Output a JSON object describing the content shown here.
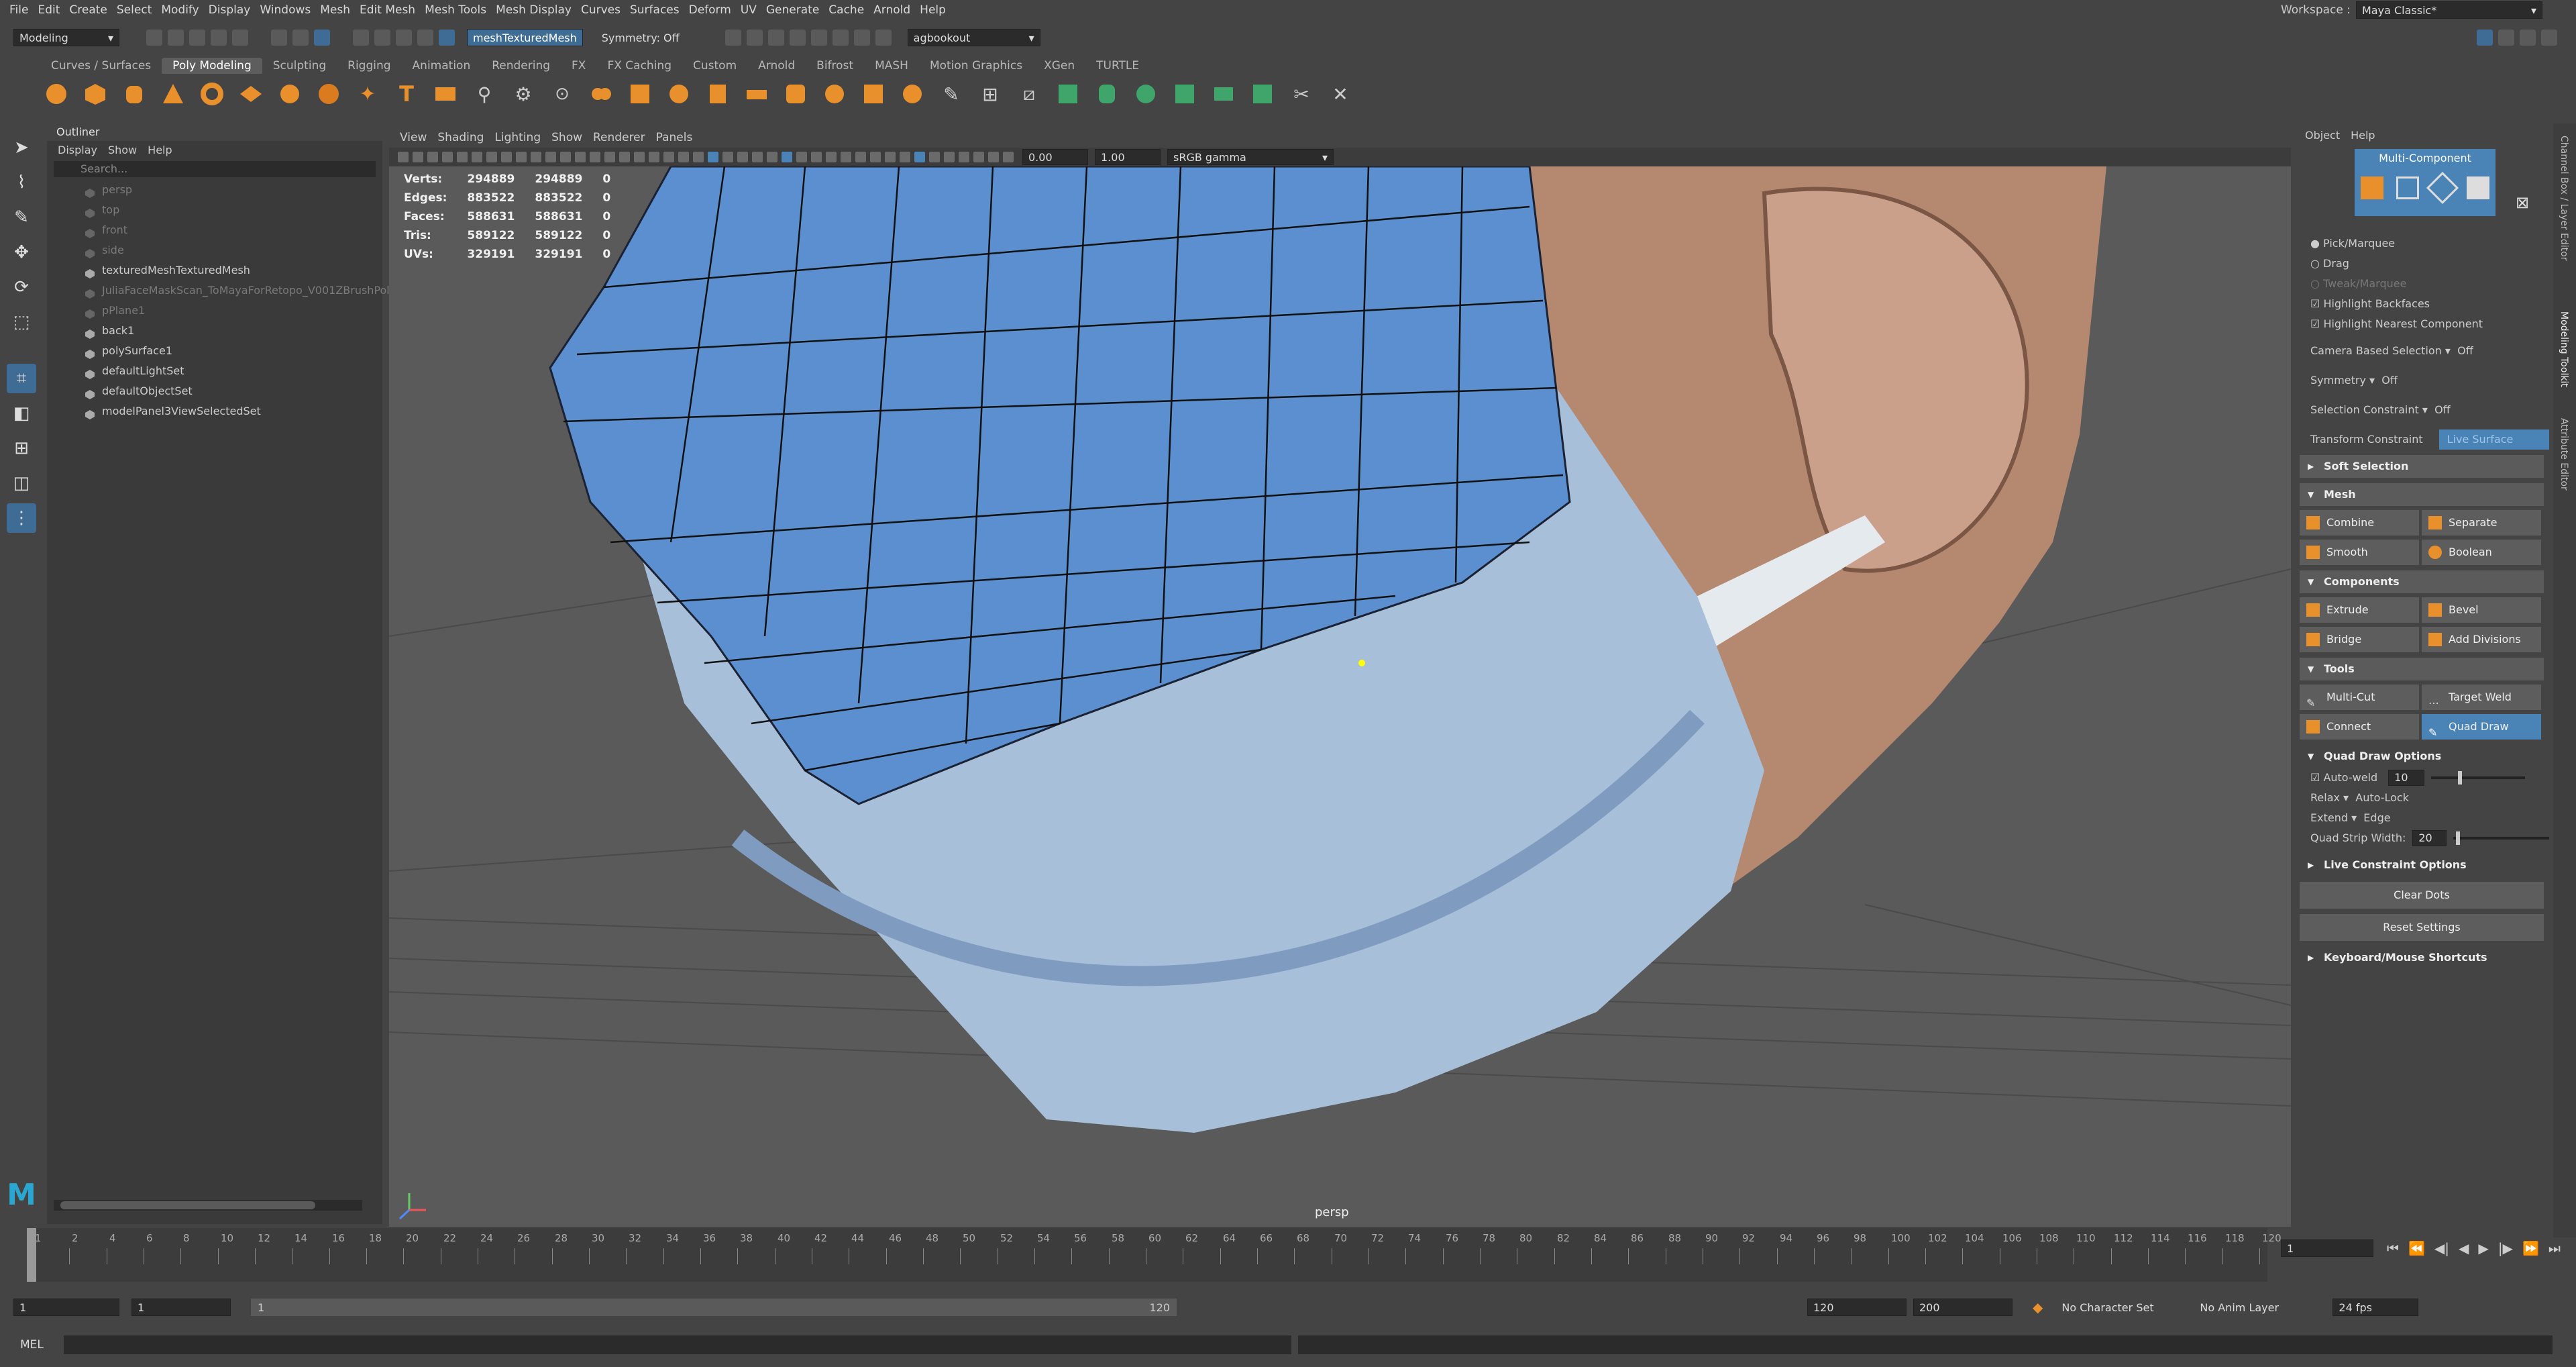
{
  "menubar": {
    "items": [
      "File",
      "Edit",
      "Create",
      "Select",
      "Modify",
      "Display",
      "Windows",
      "Mesh",
      "Edit Mesh",
      "Mesh Tools",
      "Mesh Display",
      "Curves",
      "Surfaces",
      "Deform",
      "UV",
      "Generate",
      "Cache",
      "Arnold",
      "Help"
    ]
  },
  "workspace": {
    "label": "Workspace :",
    "value": "Maya Classic*"
  },
  "statusline": {
    "mode": "Modeling",
    "live_object": "meshTexturedMesh",
    "symmetry": "Symmetry: Off",
    "camera": "agbookout"
  },
  "shelf_tabs": [
    "Curves / Surfaces",
    "Poly Modeling",
    "Sculpting",
    "Rigging",
    "Animation",
    "Rendering",
    "FX",
    "FX Caching",
    "Custom",
    "Arnold",
    "Bifrost",
    "MASH",
    "Motion Graphics",
    "XGen",
    "TURTLE"
  ],
  "shelf_active": "Poly Modeling",
  "outliner": {
    "title": "Outliner",
    "menu": [
      "Display",
      "Show",
      "Help"
    ],
    "search_placeholder": "Search...",
    "items": [
      {
        "label": "persp",
        "dim": true
      },
      {
        "label": "top",
        "dim": true
      },
      {
        "label": "front",
        "dim": true
      },
      {
        "label": "side",
        "dim": true
      },
      {
        "label": "texturedMeshTexturedMesh",
        "dim": false
      },
      {
        "label": "JuliaFaceMaskScan_ToMayaForRetopo_V001ZBrushPol",
        "dim": true
      },
      {
        "label": "pPlane1",
        "dim": true
      },
      {
        "label": "back1",
        "dim": false
      },
      {
        "label": "polySurface1",
        "dim": false
      },
      {
        "label": "defaultLightSet",
        "dim": false
      },
      {
        "label": "defaultObjectSet",
        "dim": false
      },
      {
        "label": "modelPanel3ViewSelectedSet",
        "dim": false
      }
    ]
  },
  "viewport": {
    "menu": [
      "View",
      "Shading",
      "Lighting",
      "Show",
      "Renderer",
      "Panels"
    ],
    "exposure": "0.00",
    "gamma": "1.00",
    "colorspace": "sRGB gamma",
    "camera_label": "persp",
    "hud": [
      {
        "k": "Verts:",
        "a": "294889",
        "b": "294889",
        "c": "0"
      },
      {
        "k": "Edges:",
        "a": "883522",
        "b": "883522",
        "c": "0"
      },
      {
        "k": "Faces:",
        "a": "588631",
        "b": "588631",
        "c": "0"
      },
      {
        "k": "Tris:",
        "a": "589122",
        "b": "589122",
        "c": "0"
      },
      {
        "k": "UVs:",
        "a": "329191",
        "b": "329191",
        "c": "0"
      }
    ]
  },
  "modeling_toolkit": {
    "menu": [
      "Object",
      "Help"
    ],
    "multi_component": "Multi-Component",
    "options": [
      "Pick/Marquee",
      "Drag",
      "Tweak/Marquee"
    ],
    "checks": [
      "Highlight Backfaces",
      "Highlight Nearest Component"
    ],
    "camera_based": {
      "label": "Camera Based Selection",
      "value": "Off"
    },
    "symmetry": {
      "label": "Symmetry",
      "value": "Off"
    },
    "selection_constraint": {
      "label": "Selection Constraint",
      "value": "Off"
    },
    "transform_constraint": {
      "label": "Transform Constraint",
      "value": "Live Surface"
    },
    "soft_selection": "Soft Selection",
    "mesh": {
      "title": "Mesh",
      "buttons": [
        "Combine",
        "Separate",
        "Smooth",
        "Boolean"
      ]
    },
    "components": {
      "title": "Components",
      "buttons": [
        "Extrude",
        "Bevel",
        "Bridge",
        "Add Divisions"
      ]
    },
    "tools": {
      "title": "Tools",
      "buttons": [
        "Multi-Cut",
        "Target Weld",
        "Connect",
        "Quad Draw"
      ]
    },
    "quad_draw": {
      "title": "Quad Draw Options",
      "autoweld": "Auto-weld",
      "autoweld_val": "10",
      "relax": "Relax",
      "relax_val": "Auto-Lock",
      "extend": "Extend",
      "extend_val": "Edge",
      "strip": "Quad Strip Width:",
      "strip_val": "20"
    },
    "live_constraint": "Live Constraint Options",
    "clear_dots": "Clear Dots",
    "reset": "Reset Settings",
    "shortcuts": "Keyboard/Mouse Shortcuts"
  },
  "side_tabs": [
    "Channel Box / Layer Editor",
    "Modeling Toolkit",
    "Attribute Editor"
  ],
  "time": {
    "ticks": [
      "1",
      "2",
      "4",
      "6",
      "8",
      "10",
      "12",
      "14",
      "16",
      "18",
      "20",
      "22",
      "24",
      "26",
      "28",
      "30",
      "32",
      "34",
      "36",
      "38",
      "40",
      "42",
      "44",
      "46",
      "48",
      "50",
      "52",
      "54",
      "56",
      "58",
      "60",
      "62",
      "64",
      "66",
      "68",
      "70",
      "72",
      "74",
      "76",
      "78",
      "80",
      "82",
      "84",
      "86",
      "88",
      "90",
      "92",
      "94",
      "96",
      "98",
      "100",
      "102",
      "104",
      "106",
      "108",
      "110",
      "112",
      "114",
      "116",
      "118",
      "120"
    ],
    "current": "1",
    "range_start": "1",
    "range_inner_start": "1",
    "range_slider_left": "1",
    "range_slider_right": "120",
    "range_end": "120",
    "anim_end": "200",
    "char_set": "No Character Set",
    "anim_layer": "No Anim Layer",
    "fps": "24 fps"
  },
  "cmdline": {
    "label": "MEL"
  }
}
